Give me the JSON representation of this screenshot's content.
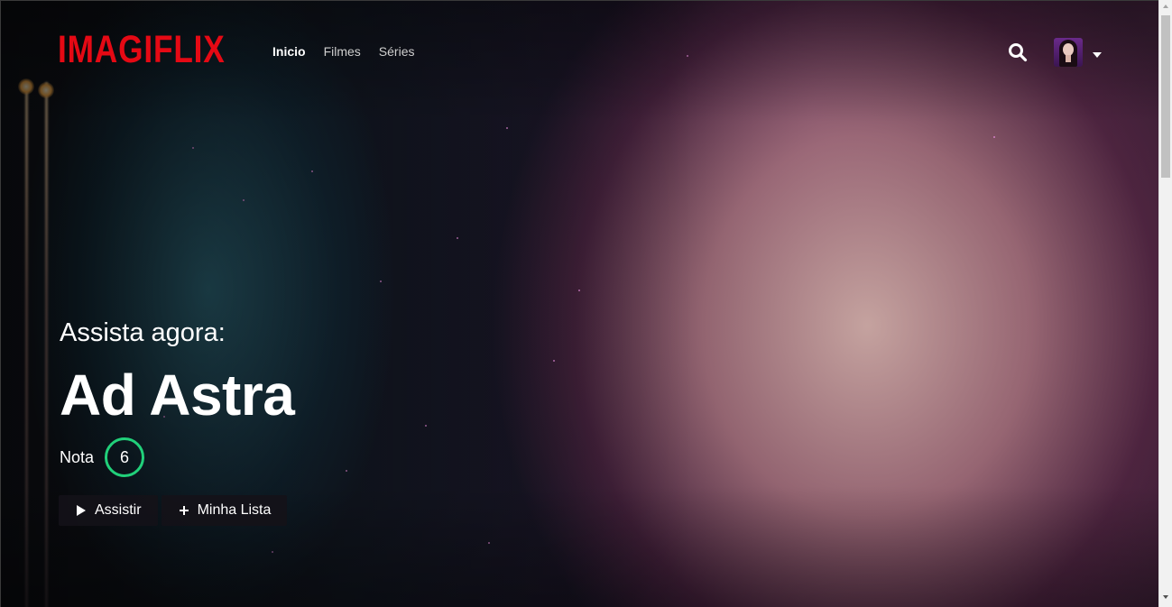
{
  "brand": {
    "logo_text": "IMAGIFLIX",
    "color": "#e50914"
  },
  "nav": {
    "items": [
      {
        "label": "Inicio",
        "active": true
      },
      {
        "label": "Filmes",
        "active": false
      },
      {
        "label": "Séries",
        "active": false
      }
    ]
  },
  "header": {
    "search_icon": "search-icon",
    "avatar_icon": "user-avatar",
    "menu_icon": "caret-down-icon"
  },
  "featured": {
    "label": "Assista agora:",
    "title": "Ad Astra",
    "rating_label": "Nota",
    "rating_value": "6",
    "rating_color": "#21d07a"
  },
  "actions": {
    "watch_label": "Assistir",
    "watch_icon": "play-icon",
    "mylist_label": "Minha Lista",
    "mylist_icon": "plus-icon"
  }
}
